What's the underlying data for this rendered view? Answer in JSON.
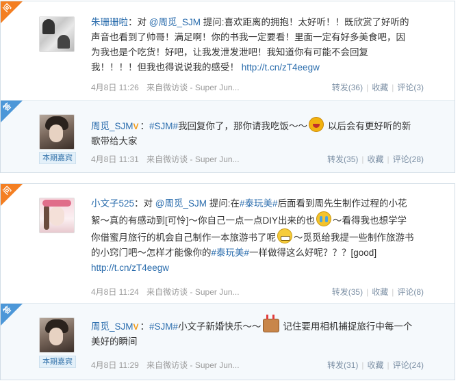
{
  "threads": [
    {
      "question": {
        "corner_char": "问",
        "user": "朱珊珊啦",
        "segments": [
          {
            "t": "：对 ",
            "c": "plain"
          },
          {
            "t": "@周觅_SJM",
            "c": "mention"
          },
          {
            "t": " 提问:喜欢距离的拥抱！太好听！！既欣赏了好听的",
            "c": "plain"
          }
        ],
        "line2": "声音也看到了帅哥！满足啊！你的书我一定要看！里面一定有好多美食吧，因",
        "line3": "为我也是个吃货！好吧，让我发泄发泄吧！我知道你有可能不会回复",
        "line4a": "我！！！！但我也得说说我的感受！ ",
        "line4_link": "http://t.cn/zT4eegw",
        "time": "4月8日 11:26",
        "source": "来自微访谈 - Super Jun...",
        "repost": "转发(36)",
        "fav": "收藏",
        "comment": "评论(3)"
      },
      "answer": {
        "corner_char": "答",
        "user": "周觅_SJM",
        "vmark": "V",
        "tag": "#SJM#",
        "text1": "我回复你了，那你请我吃饭～～",
        "text2": "以后会有更好听的新",
        "line2": "歌带给大家",
        "badge": "本期嘉宾",
        "time": "4月8日 11:31",
        "source": "来自微访谈 - Super Jun...",
        "repost": "转发(35)",
        "fav": "收藏",
        "comment": "评论(28)"
      }
    },
    {
      "question": {
        "corner_char": "问",
        "user": "小文子525",
        "line1a": "：对 ",
        "line1_mention": "@周觅_SJM",
        "line1b": " 提问:在",
        "line1_tag": "#泰玩美#",
        "line1c": "后面看到周先生制作过程的小花",
        "line2a": "絮～真的有感动到[可怜]～你自己一点一点DIY出来的也",
        "line2b": "～看得我也想学学",
        "line3a": "你借蜜月旅行的机会自己制作一本旅游书了呢",
        "line3b": "～觅觅给我提一些制作旅游书",
        "line4a": "的小窍门吧～怎样才能像你的",
        "line4_tag": "#泰玩美#",
        "line4b": "一样做得这么好呢？？？[good]",
        "line5_link": "http://t.cn/zT4eegw",
        "time": "4月8日 11:24",
        "source": "来自微访谈 - Super Jun...",
        "repost": "转发(35)",
        "fav": "收藏",
        "comment": "评论(8)"
      },
      "answer": {
        "corner_char": "答",
        "user": "周觅_SJM",
        "vmark": "V",
        "tag": "#SJM#",
        "text1": "小文子新婚快乐～～",
        "text2": "记住要用相机捕捉旅行中每一个",
        "line2": "美好的瞬间",
        "badge": "本期嘉宾",
        "time": "4月8日 11:29",
        "source": "来自微访谈 - Super Jun...",
        "repost": "转发(31)",
        "fav": "收藏",
        "comment": "评论(24)"
      }
    }
  ],
  "colors": {
    "question_corner": "#f47f22",
    "answer_corner": "#4c97d8",
    "link": "#2b6dad",
    "meta": "#9a9a9a",
    "border": "#d2dde6"
  },
  "icons": [
    "laugh-emoji-icon",
    "cry-emoji-icon",
    "grin-emoji-icon",
    "cake-emoji-icon",
    "verified-v-icon"
  ]
}
